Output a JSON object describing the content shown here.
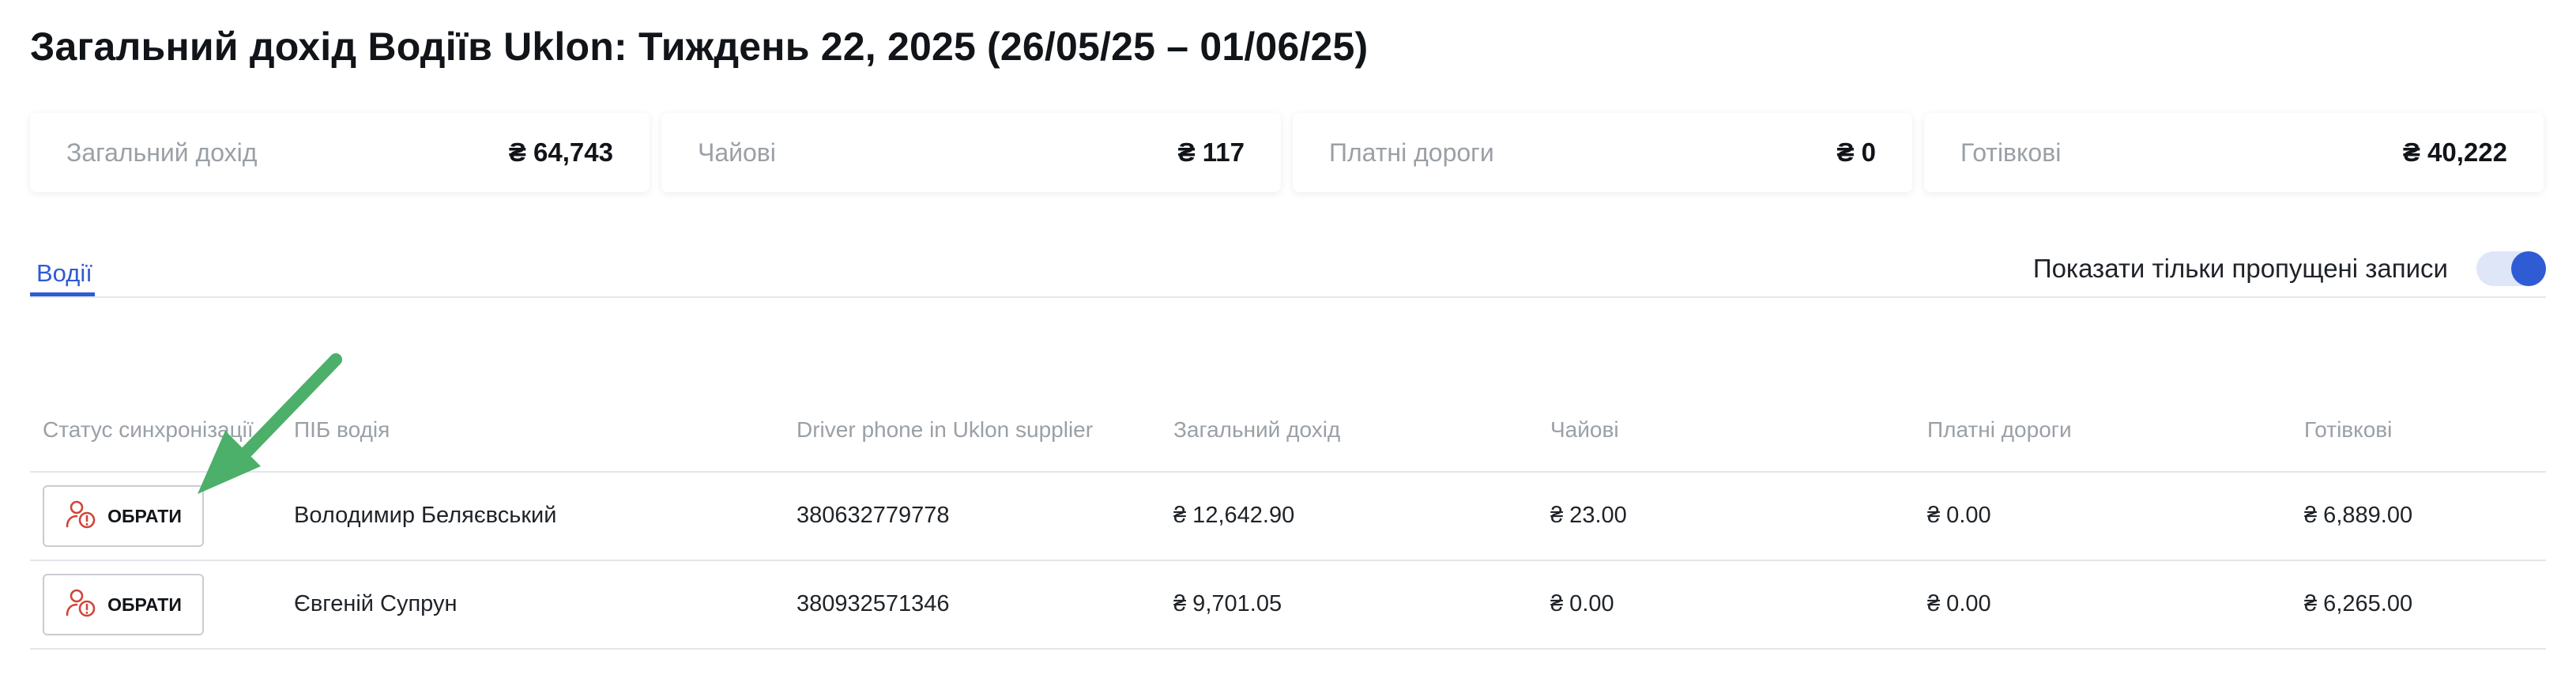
{
  "title": "Загальний дохід Водіїв Uklon: Тиждень 22, 2025 (26/05/25 – 01/06/25)",
  "stats": [
    {
      "label": "Загальний дохід",
      "value": "₴ 64,743"
    },
    {
      "label": "Чайові",
      "value": "₴ 117"
    },
    {
      "label": "Платні дороги",
      "value": "₴ 0"
    },
    {
      "label": "Готівкові",
      "value": "₴ 40,222"
    }
  ],
  "tabs": [
    {
      "label": "Водії",
      "active": true
    }
  ],
  "toggle": {
    "label": "Показати тільки пропущені записи",
    "on": true
  },
  "table": {
    "headers": [
      "Статус синхронізації",
      "ПІБ водія",
      "Driver phone in Uklon supplier",
      "Загальний дохід",
      "Чайові",
      "Платні дороги",
      "Готівкові"
    ],
    "rows": [
      {
        "action": "ОБРАТИ",
        "name": "Володимир Беляєвський",
        "phone": "380632779778",
        "total": "₴ 12,642.90",
        "tips": "₴ 23.00",
        "tolls": "₴ 0.00",
        "cash": "₴ 6,889.00"
      },
      {
        "action": "ОБРАТИ",
        "name": "Євгеній Супрун",
        "phone": "380932571346",
        "total": "₴ 9,701.05",
        "tips": "₴ 0.00",
        "tolls": "₴ 0.00",
        "cash": "₴ 6,265.00"
      }
    ]
  },
  "icons": {
    "select_button_icon": "user-alert-icon",
    "annotation": "arrow-icon"
  },
  "colors": {
    "accent": "#2f5bd4",
    "button_icon": "#d0453a",
    "annotation_arrow": "#4caf6a"
  }
}
